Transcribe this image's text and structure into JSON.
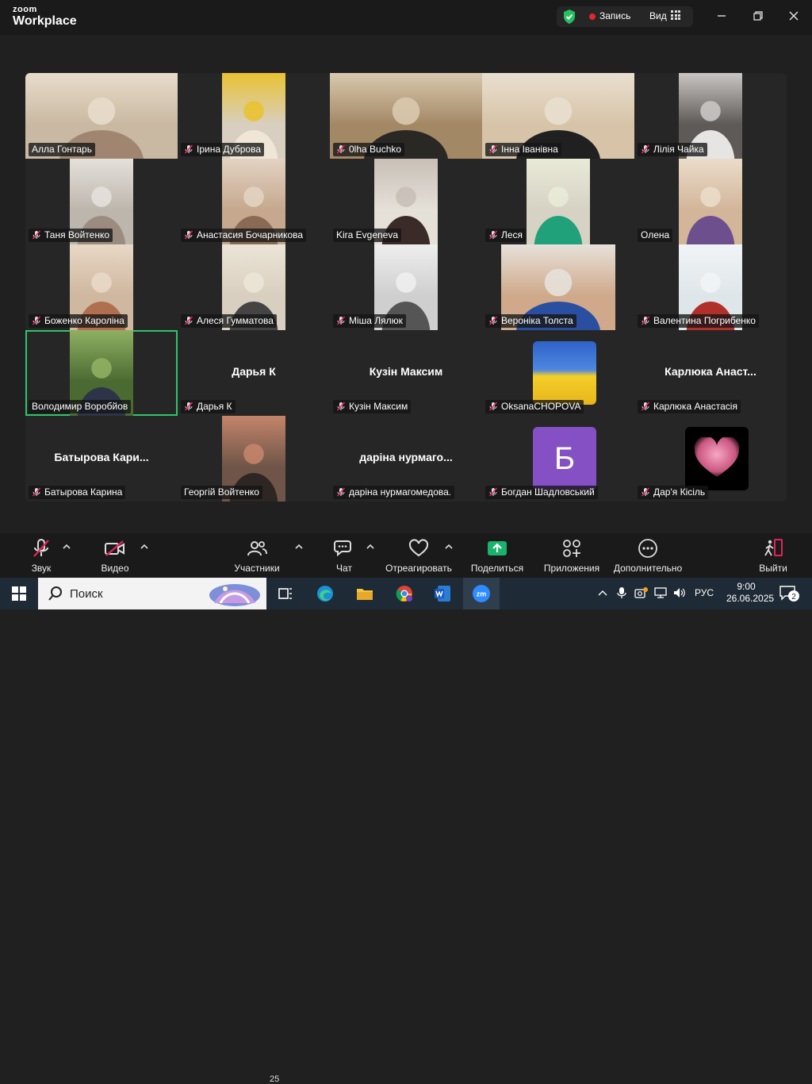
{
  "titlebar": {
    "brand_small": "zoom",
    "brand_large": "Workplace",
    "record_label": "Запись",
    "view_label": "Вид"
  },
  "participants": [
    {
      "name": "Алла Гонтарь",
      "muted": false,
      "type": "video",
      "colors": [
        "#c9b9a2",
        "#e8dccb",
        "#a08670"
      ]
    },
    {
      "name": "Ірина Дуброва",
      "muted": true,
      "type": "video",
      "colors": [
        "#d8cfc0",
        "#e9c232",
        "#f0e6d6"
      ]
    },
    {
      "name": "0lha Buchko",
      "muted": true,
      "type": "video",
      "colors": [
        "#a38866",
        "#d9c9ae",
        "#2a2824"
      ]
    },
    {
      "name": "Інна Іванівна",
      "muted": true,
      "type": "video",
      "colors": [
        "#d7c4a8",
        "#e9dfcf",
        "#202020"
      ]
    },
    {
      "name": "Лілія Чайка",
      "muted": true,
      "type": "video",
      "colors": [
        "#5e5a58",
        "#c9c6c4",
        "#e7e5e4"
      ]
    },
    {
      "name": "Таня Войтенко",
      "muted": true,
      "type": "video",
      "colors": [
        "#bdb6ad",
        "#e4e0da",
        "#9c8c80"
      ]
    },
    {
      "name": "Анастасия Бочарникова",
      "muted": true,
      "type": "video",
      "colors": [
        "#c5a88e",
        "#e3d3c2",
        "#8a6a55"
      ]
    },
    {
      "name": "Kira Evgeneva",
      "muted": false,
      "type": "video",
      "colors": [
        "#e5e0d8",
        "#c8c0b7",
        "#3b2b28"
      ]
    },
    {
      "name": "Леся",
      "muted": true,
      "type": "video",
      "colors": [
        "#d6d2c4",
        "#e9ead8",
        "#21a17a"
      ]
    },
    {
      "name": "Олена",
      "muted": false,
      "type": "video",
      "colors": [
        "#d3b59a",
        "#eadcc9",
        "#6c4f8c"
      ]
    },
    {
      "name": "Боженко Кароліна",
      "muted": true,
      "type": "video",
      "colors": [
        "#cfb7a0",
        "#e8d8c5",
        "#b07050"
      ]
    },
    {
      "name": "Алеся Гумматова",
      "muted": true,
      "type": "video",
      "colors": [
        "#d8cfc0",
        "#ece4d6",
        "#444444"
      ]
    },
    {
      "name": "Міша Лялюк",
      "muted": true,
      "type": "video",
      "colors": [
        "#cfcfcf",
        "#eeeeee",
        "#555555"
      ]
    },
    {
      "name": "Вероніка Толста",
      "muted": true,
      "type": "video",
      "colors": [
        "#cfa98a",
        "#e7e1da",
        "#2a4fa0"
      ]
    },
    {
      "name": "Валентина Погрибенко",
      "muted": true,
      "type": "video",
      "colors": [
        "#dfe6e9",
        "#f1f4f6",
        "#b0302a"
      ]
    },
    {
      "name": "Володимир Воробйов",
      "muted": false,
      "type": "video",
      "active": true,
      "colors": [
        "#4a6a32",
        "#8fb062",
        "#2c3448"
      ]
    },
    {
      "name": "Дарья К",
      "muted": true,
      "type": "name",
      "big": "Дарья К"
    },
    {
      "name": "Кузін Максим",
      "muted": true,
      "type": "name",
      "big": "Кузін Максим"
    },
    {
      "name": "OksanaCHOPOVA",
      "muted": true,
      "type": "flag"
    },
    {
      "name": "Карлюка Анастасія",
      "muted": true,
      "type": "name",
      "big": "Карлюка  Анаст..."
    },
    {
      "name": "Батырова Карина",
      "muted": true,
      "type": "name",
      "big": "Батырова  Кари..."
    },
    {
      "name": "Георгій Войтенко",
      "muted": false,
      "type": "video",
      "colors": [
        "#6e5548",
        "#c4846a",
        "#2e2622"
      ]
    },
    {
      "name": "даріна нурмагомедова.",
      "muted": true,
      "type": "name",
      "big": "даріна  нурмаго..."
    },
    {
      "name": "Богдан Шадловський",
      "muted": true,
      "type": "letter",
      "letter": "Б",
      "color": "#8550c4"
    },
    {
      "name": "Дар'я Кісіль",
      "muted": true,
      "type": "heart"
    }
  ],
  "toolbar": {
    "audio": "Звук",
    "video": "Видео",
    "participants": "Участники",
    "participants_count": "25",
    "chat": "Чат",
    "react": "Отреагировать",
    "share": "Поделиться",
    "apps": "Приложения",
    "more": "Дополнительно",
    "leave": "Выйти"
  },
  "taskbar": {
    "search_placeholder": "Поиск",
    "lang": "РУС",
    "time": "9:00",
    "date": "26.06.2025",
    "notif_count": "2"
  },
  "colors": {
    "active_speaker": "#2ec66a",
    "share_green": "#19b36b",
    "leave_red": "#e0245e"
  }
}
